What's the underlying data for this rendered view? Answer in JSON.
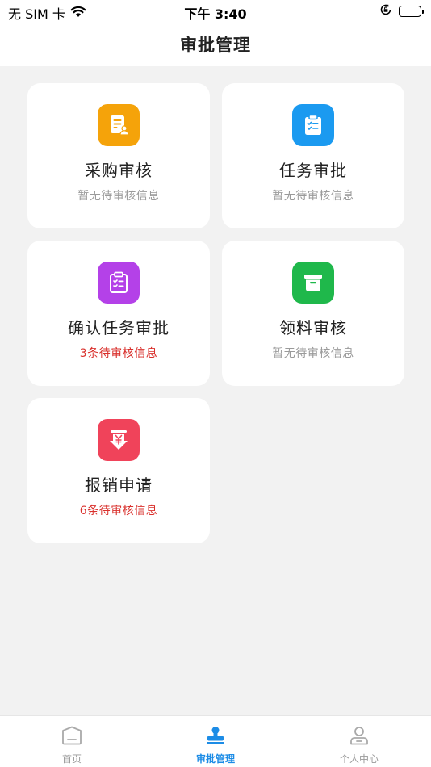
{
  "status_bar": {
    "carrier": "无 SIM 卡",
    "time": "下午 3:40"
  },
  "nav": {
    "title": "审批管理"
  },
  "cards": [
    {
      "title": "采购审核",
      "subtitle": "暂无待审核信息",
      "icon": "purchase-document-icon",
      "color": "#f5a30a",
      "alert": false
    },
    {
      "title": "任务审批",
      "subtitle": "暂无待审核信息",
      "icon": "task-clipboard-icon",
      "color": "#1b9af0",
      "alert": false
    },
    {
      "title": "确认任务审批",
      "subtitle": "3条待审核信息",
      "icon": "confirm-checklist-icon",
      "color": "#b441e8",
      "alert": true
    },
    {
      "title": "领料审核",
      "subtitle": "暂无待审核信息",
      "icon": "material-box-icon",
      "color": "#1fb84b",
      "alert": false
    },
    {
      "title": "报销申请",
      "subtitle": "6条待审核信息",
      "icon": "reimbursement-yen-icon",
      "color": "#f0435a",
      "alert": true
    }
  ],
  "colors": {
    "alert_text": "#d9302c",
    "muted_text": "#9a9a9a",
    "active_tab": "#1c8ce6"
  },
  "tabs": [
    {
      "label": "首页",
      "icon": "home-icon",
      "active": false
    },
    {
      "label": "审批管理",
      "icon": "approval-stamp-icon",
      "active": true
    },
    {
      "label": "个人中心",
      "icon": "profile-icon",
      "active": false
    }
  ]
}
